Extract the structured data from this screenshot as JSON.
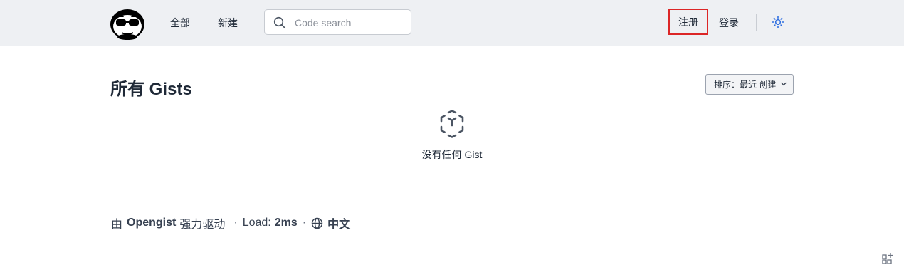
{
  "header": {
    "nav": {
      "all": "全部",
      "new": "新建"
    },
    "search": {
      "placeholder": "Code search",
      "value": ""
    },
    "register": "注册",
    "login": "登录",
    "icons": {
      "logo": "opengist-logo",
      "search": "search-icon",
      "theme": "sun-icon"
    }
  },
  "main": {
    "title": "所有 Gists",
    "sort_label": "排序：最近 创建",
    "empty_message": "没有任何 Gist",
    "empty_icon": "cube-icon"
  },
  "footer": {
    "powered_prefix": "由",
    "powered_name": "Opengist",
    "powered_suffix": "强力驱动",
    "load_label": "Load:",
    "load_value": "2ms",
    "language": "中文",
    "language_icon": "globe-icon"
  },
  "colors": {
    "header_bg": "#eef0f3",
    "highlight_border": "#dc2626",
    "theme_icon": "#2f6fe0"
  }
}
